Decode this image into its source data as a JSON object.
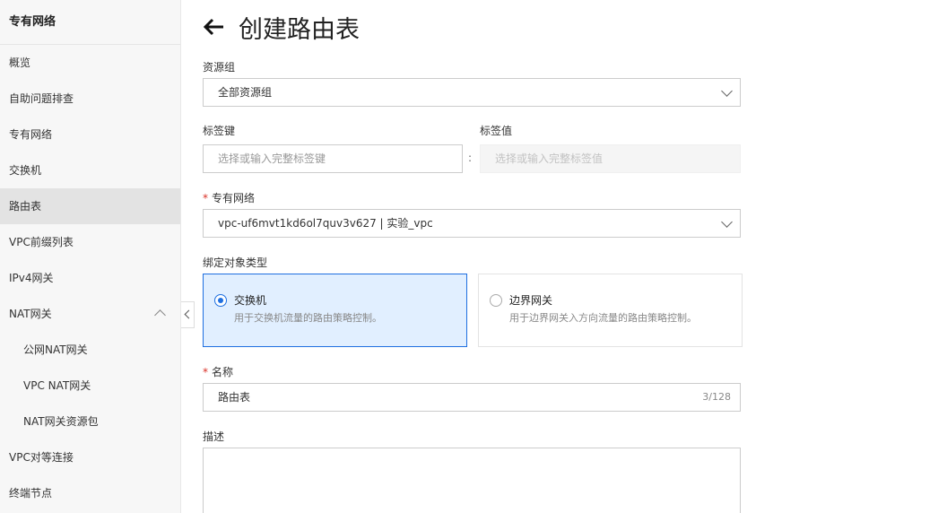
{
  "sidebar": {
    "title": "专有网络",
    "items": [
      {
        "label": "概览"
      },
      {
        "label": "自助问题排查"
      },
      {
        "label": "专有网络"
      },
      {
        "label": "交换机"
      },
      {
        "label": "路由表"
      },
      {
        "label": "VPC前缀列表"
      },
      {
        "label": "IPv4网关"
      },
      {
        "label": "NAT网关"
      },
      {
        "label": "公网NAT网关"
      },
      {
        "label": "VPC NAT网关"
      },
      {
        "label": "NAT网关资源包"
      },
      {
        "label": "VPC对等连接"
      },
      {
        "label": "终端节点"
      }
    ],
    "active_item": "路由表"
  },
  "page": {
    "title": "创建路由表"
  },
  "form": {
    "resource_group": {
      "label": "资源组",
      "value": "全部资源组"
    },
    "tag_key": {
      "label": "标签键",
      "placeholder": "选择或输入完整标签键"
    },
    "tag_separator": ":",
    "tag_value": {
      "label": "标签值",
      "placeholder": "选择或输入完整标签值"
    },
    "vpc": {
      "required_mark": "*",
      "label": "专有网络",
      "value": "vpc-uf6mvt1kd6ol7quv3v627 | 实验_vpc"
    },
    "bind_type": {
      "label": "绑定对象类型",
      "options": [
        {
          "title": "交换机",
          "desc": "用于交换机流量的路由策略控制。",
          "selected": true
        },
        {
          "title": "边界网关",
          "desc": "用于边界网关入方向流量的路由策略控制。",
          "selected": false
        }
      ]
    },
    "name": {
      "required_mark": "*",
      "label": "名称",
      "value": "路由表",
      "counter": "3/128"
    },
    "description": {
      "label": "描述"
    }
  },
  "colors": {
    "accent": "#1e6fe0",
    "selected_card_bg": "#e1efff",
    "required": "#d93026"
  }
}
